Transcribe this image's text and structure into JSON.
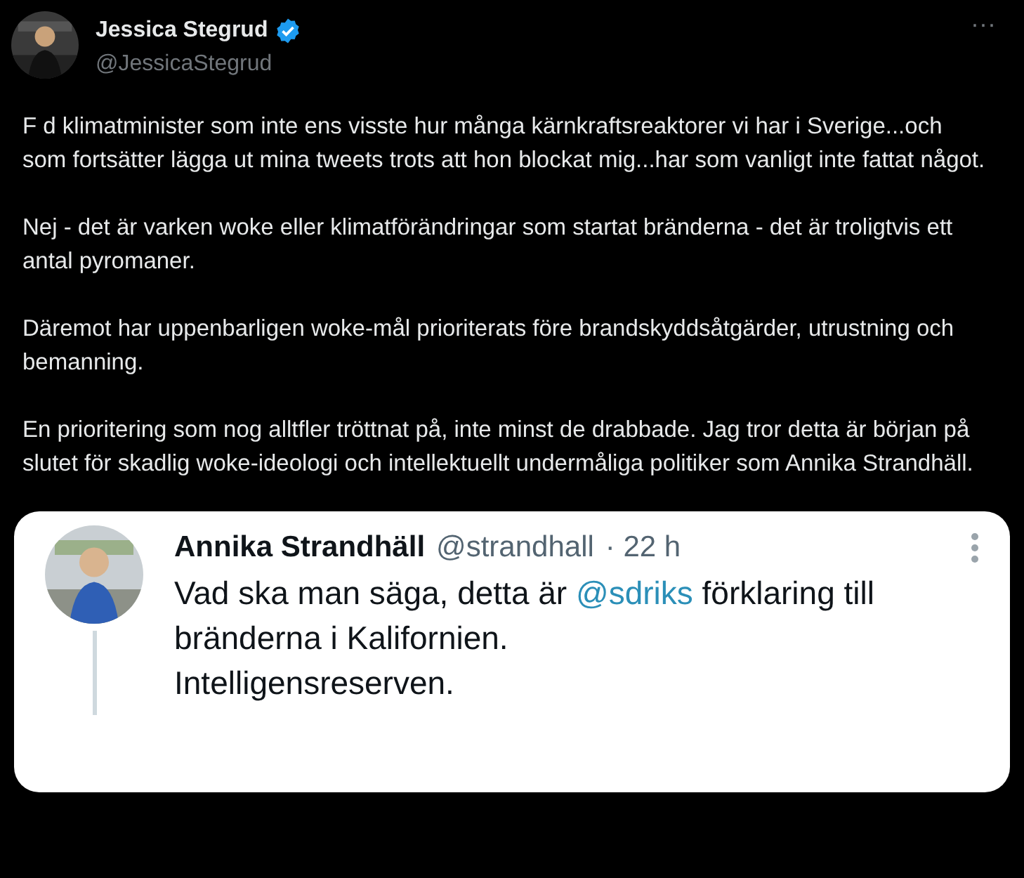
{
  "author": {
    "name": "Jessica Stegrud",
    "verified": true,
    "handle": "@JessicaStegrud"
  },
  "more": "···",
  "paragraphs": [
    "F d klimatminister som inte ens visste hur många kärnkraftsreaktorer vi har i Sverige...och som fortsätter lägga ut mina tweets trots att hon blockat mig...har som vanligt inte fattat något.",
    "Nej - det är varken woke eller klimatförändringar som startat bränderna - det är troligtvis ett antal pyromaner.",
    "Däremot har uppenbarligen woke-mål prioriterats före brandskyddsåtgärder, utrustning och bemanning.",
    "En prioritering som nog alltfler tröttnat på, inte minst de drabbade. Jag tror detta är början på slutet för skadlig woke-ideologi och intellektuellt undermåliga politiker som Annika Strandhäll."
  ],
  "quoted": {
    "name": "Annika Strandhäll",
    "handle": "@strandhall",
    "time": "· 22 h",
    "lines": [
      [
        {
          "kind": "text",
          "text": "Vad ska man säga, detta är "
        },
        {
          "kind": "mention",
          "text": "@sdriks"
        },
        {
          "kind": "text",
          "text": " förklaring till"
        }
      ],
      [
        {
          "kind": "text",
          "text": "bränderna i Kalifornien."
        }
      ],
      [
        {
          "kind": "text",
          "text": "Intelligensreserven."
        }
      ]
    ]
  }
}
